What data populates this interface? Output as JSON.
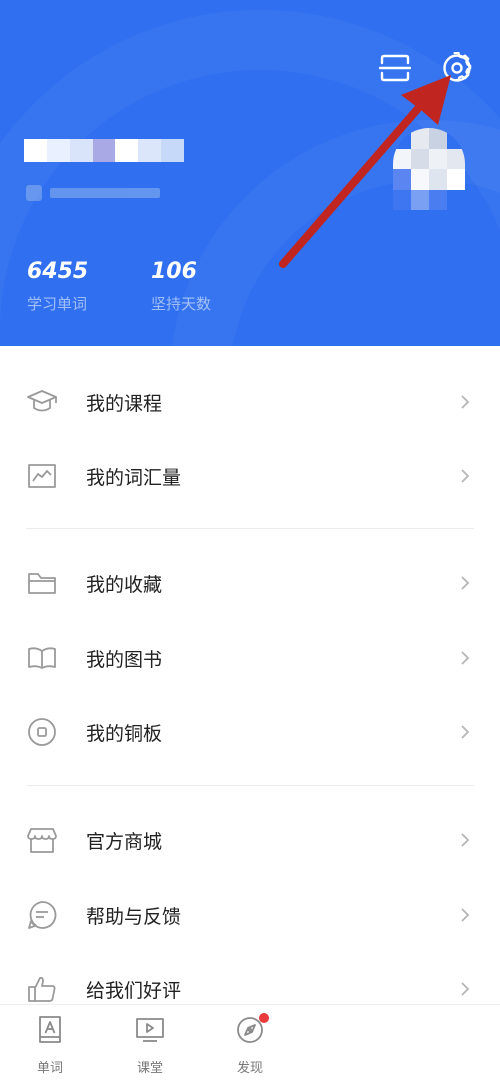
{
  "header": {
    "background_color": "#2f6ff0",
    "icons": {
      "scan": "scan-icon",
      "settings": "gear-icon"
    },
    "username_redacted": true,
    "user_id_redacted": true,
    "avatar_redacted": true,
    "stats": [
      {
        "value": "6455",
        "label": "学习单词"
      },
      {
        "value": "106",
        "label": "坚持天数"
      }
    ]
  },
  "annotation": {
    "type": "arrow",
    "color": "#c0251f",
    "points_to": "settings"
  },
  "menu": {
    "groups": [
      [
        {
          "label": "我的课程",
          "icon": "graduation-cap-icon"
        },
        {
          "label": "我的词汇量",
          "icon": "chart-line-icon"
        }
      ],
      [
        {
          "label": "我的收藏",
          "icon": "folder-icon"
        },
        {
          "label": "我的图书",
          "icon": "book-open-icon"
        },
        {
          "label": "我的铜板",
          "icon": "coin-icon"
        }
      ],
      [
        {
          "label": "官方商城",
          "icon": "shop-icon"
        },
        {
          "label": "帮助与反馈",
          "icon": "chat-bubble-icon"
        },
        {
          "label": "给我们好评",
          "icon": "thumbs-up-icon"
        }
      ]
    ]
  },
  "bottom_nav": {
    "items": [
      {
        "label": "单词",
        "icon": "word-card-icon"
      },
      {
        "label": "课堂",
        "icon": "video-play-icon"
      },
      {
        "label": "发现",
        "icon": "compass-icon",
        "badge": true
      }
    ],
    "badge_color": "#e93b3b"
  }
}
